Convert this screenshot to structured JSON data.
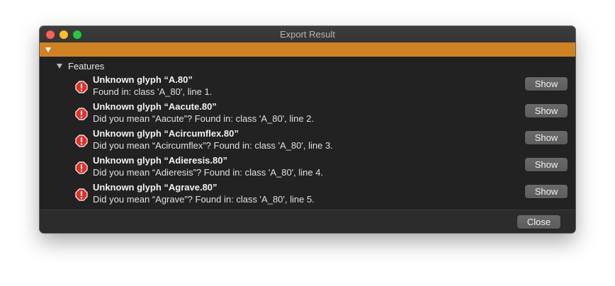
{
  "window": {
    "title": "Export Result"
  },
  "section": {
    "label": "Features"
  },
  "issues": [
    {
      "title": "Unknown glyph “A.80”",
      "detail": "Found in: class 'A_80', line 1.",
      "button": "Show"
    },
    {
      "title": "Unknown glyph “Aacute.80”",
      "detail": "Did you mean “Aacute”? Found in: class 'A_80', line 2.",
      "button": "Show"
    },
    {
      "title": "Unknown glyph “Acircumflex.80”",
      "detail": "Did you mean “Acircumflex”? Found in: class 'A_80', line 3.",
      "button": "Show"
    },
    {
      "title": "Unknown glyph “Adieresis.80”",
      "detail": "Did you mean “Adieresis”? Found in: class 'A_80', line 4.",
      "button": "Show"
    },
    {
      "title": "Unknown glyph “Agrave.80”",
      "detail": "Did you mean “Agrave”? Found in: class 'A_80', line 5.",
      "button": "Show"
    }
  ],
  "footer": {
    "close_label": "Close"
  },
  "icons": {
    "issue": "error-exclamation-icon",
    "disclosure": "disclosure-triangle-icon"
  },
  "colors": {
    "status_bar": "#cf8224",
    "error_icon": "#e0312b"
  }
}
